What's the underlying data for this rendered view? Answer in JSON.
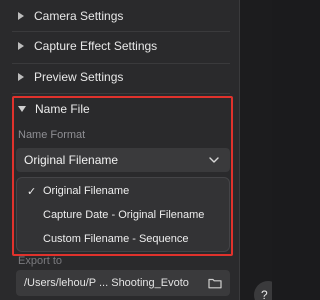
{
  "sections": [
    {
      "label": "Camera Settings"
    },
    {
      "label": "Capture Effect Settings"
    },
    {
      "label": "Preview Settings"
    }
  ],
  "name_file": {
    "title": "Name File",
    "name_format_label": "Name Format",
    "selected": "Original Filename",
    "options": [
      {
        "label": "Original Filename",
        "checked": true
      },
      {
        "label": "Capture Date - Original Filename",
        "checked": false
      },
      {
        "label": "Custom Filename - Sequence",
        "checked": false
      }
    ]
  },
  "export": {
    "label": "Export to",
    "path": "/Users/lehou/P ... Shooting_Evoto"
  },
  "help": {
    "label": "?"
  },
  "colors": {
    "highlight": "#e0322c",
    "panel": "#2a2a2c",
    "field": "#3a3a3c"
  }
}
